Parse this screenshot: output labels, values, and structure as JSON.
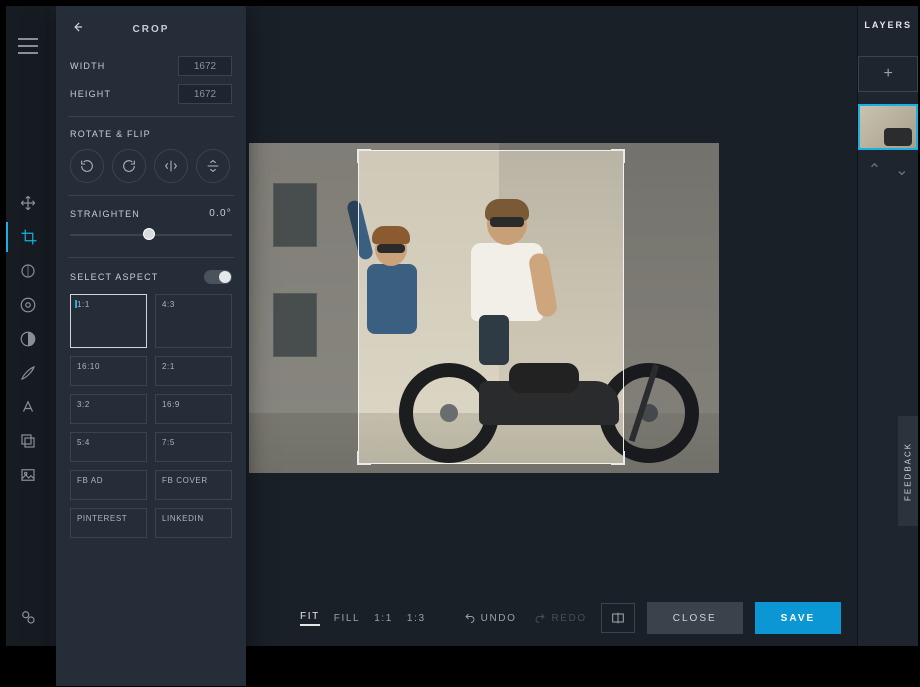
{
  "panel": {
    "title": "CROP",
    "width_label": "WIDTH",
    "width_value": "1672",
    "height_label": "HEIGHT",
    "height_value": "1672",
    "rotate_label": "ROTATE & FLIP",
    "straighten_label": "STRAIGHTEN",
    "straighten_value": "0.0°",
    "aspect_label": "SELECT ASPECT",
    "aspects": [
      "1:1",
      "4:3",
      "16:10",
      "2:1",
      "3:2",
      "16:9",
      "5:4",
      "7:5",
      "FB AD",
      "FB COVER",
      "PINTEREST",
      "LINKEDIN"
    ],
    "active_aspect_index": 0
  },
  "bottombar": {
    "fit": "FIT",
    "fill": "FILL",
    "one": "1:1",
    "onethree": "1:3",
    "undo": "UNDO",
    "redo": "REDO",
    "close": "CLOSE",
    "save": "SAVE"
  },
  "layers": {
    "title": "LAYERS"
  },
  "feedback": "FEEDBACK",
  "colors": {
    "accent": "#18b1e0",
    "save": "#0b97d4"
  }
}
